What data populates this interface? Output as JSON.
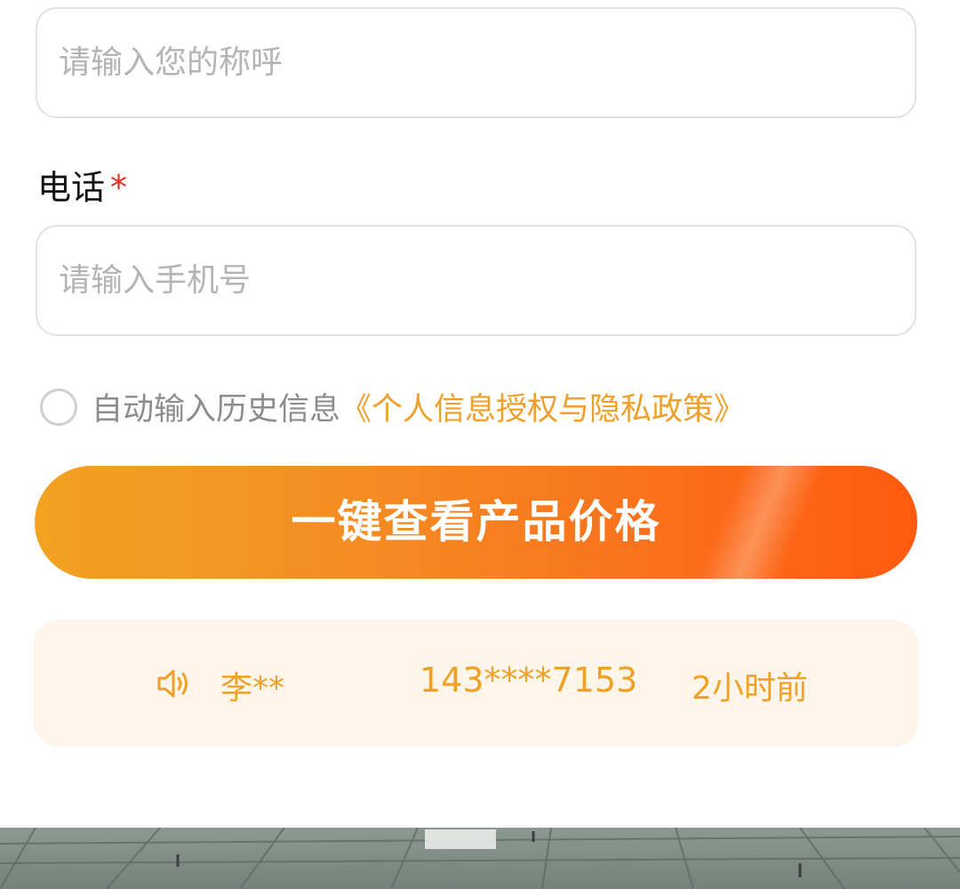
{
  "name_field": {
    "placeholder": "请输入您的称呼",
    "value": ""
  },
  "phone_field": {
    "label": "电话",
    "required_mark": "*",
    "placeholder": "请输入手机号",
    "value": ""
  },
  "consent": {
    "checked": false,
    "text": "自动输入历史信息",
    "policy_link": "《个人信息授权与隐私政策》"
  },
  "cta": {
    "label": "一键查看产品价格"
  },
  "ticker": {
    "icon": "speaker-icon",
    "name": "李**",
    "phone": "143****7153",
    "time": "2小时前"
  },
  "colors": {
    "accent": "#efa02a",
    "cta_start": "#f2a221",
    "cta_end": "#ff5a10",
    "required": "#e02a1a",
    "ticker_bg": "#fdf5ea"
  },
  "bottom_image": {
    "description_icon": "office-ceiling-photo"
  }
}
